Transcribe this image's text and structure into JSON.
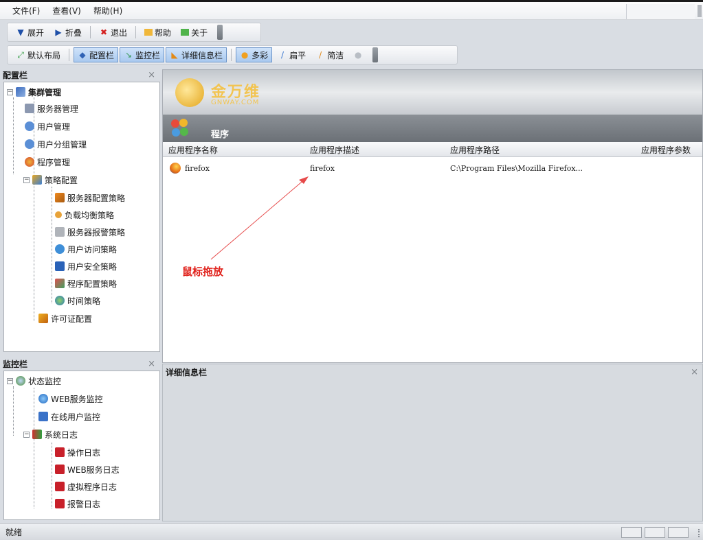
{
  "menubar": {
    "items": [
      "文件(F)",
      "查看(V)",
      "帮助(H)"
    ]
  },
  "toolbar1": {
    "expand": "展开",
    "collapse": "折叠",
    "exit": "退出",
    "help": "帮助",
    "about": "关于"
  },
  "toolbar2": {
    "default_layout": "默认布局",
    "config_bar": "配置栏",
    "monitor_bar": "监控栏",
    "detail_bar": "详细信息栏",
    "colorful": "多彩",
    "flat": "扁平",
    "simple": "简洁"
  },
  "config_panel": {
    "title": "配置栏",
    "close": "×",
    "root": "集群管理",
    "items": [
      "服务器管理",
      "用户管理",
      "用户分组管理",
      "程序管理"
    ],
    "policy": "策略配置",
    "policy_items": [
      "服务器配置策略",
      "负载均衡策略",
      "服务器报警策略",
      "用户访问策略",
      "用户安全策略",
      "程序配置策略",
      "时间策略"
    ],
    "license": "许可证配置"
  },
  "monitor_panel": {
    "title": "监控栏",
    "close": "×",
    "root": "状态监控",
    "items": [
      "WEB服务监控",
      "在线用户监控"
    ],
    "logs": "系统日志",
    "log_items": [
      "操作日志",
      "WEB服务日志",
      "虚拟程序日志",
      "报警日志"
    ]
  },
  "main": {
    "logo_text": "金万维",
    "logo_sub": "GNWAY.COM",
    "section_title": "程序",
    "columns": [
      "应用程序名称",
      "应用程序描述",
      "应用程序路径",
      "应用程序参数"
    ],
    "rows": [
      {
        "name": "firefox",
        "desc": "firefox",
        "path": "C:\\Program Files\\Mozilla Firefox..."
      }
    ],
    "annotation": "鼠标拖放"
  },
  "detail_panel": {
    "title": "详细信息栏",
    "close": "×"
  },
  "statusbar": {
    "text": "就绪"
  }
}
